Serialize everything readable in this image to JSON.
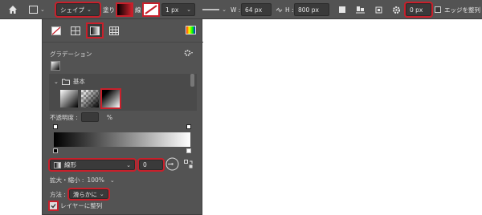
{
  "toolbar": {
    "shape_mode": "シェイプ",
    "fill_label": "塗り :",
    "stroke_label": "線 :",
    "stroke_width": "1 px",
    "w_label": "W :",
    "w_value": "64 px",
    "h_label": "H :",
    "h_value": "800 px",
    "corner_radius": "0 px",
    "align_edges": "エッジを整列"
  },
  "panel": {
    "section_title": "グラデーション",
    "folder_name": "基本",
    "opacity_label": "不透明度 :",
    "opacity_unit": "%",
    "gradient_type": "線形",
    "angle": "0",
    "scale_label": "拡大・縮小 :",
    "scale_value": "100%",
    "method_label": "方法 :",
    "method_value": "滑らかに",
    "align_layer": "レイヤーに整列"
  },
  "colors": {
    "highlight": "#c8202b",
    "panel_bg": "#535353",
    "field_bg": "#3a3a3a"
  }
}
